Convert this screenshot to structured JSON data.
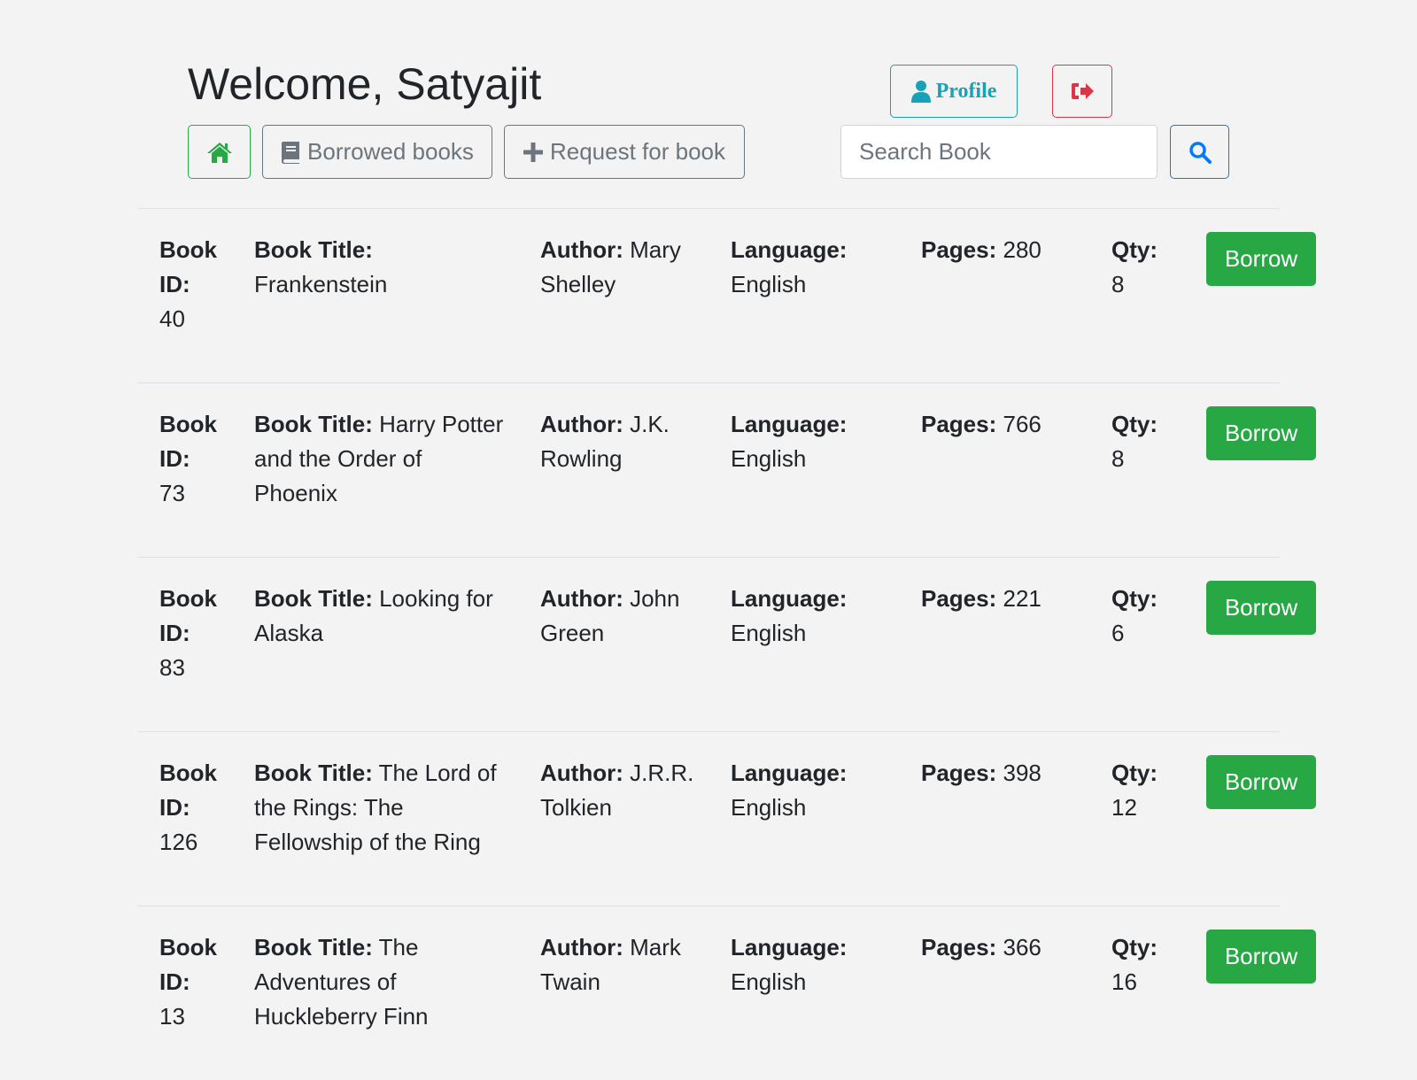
{
  "header": {
    "welcome": "Welcome, Satyajit",
    "profile_label": "Profile",
    "nav": {
      "borrowed_label": "Borrowed books",
      "request_label": "Request for book"
    },
    "search": {
      "placeholder": "Search Book",
      "value": ""
    }
  },
  "labels": {
    "book_id": "Book ID:",
    "title": "Book Title:",
    "author": "Author:",
    "language": "Language:",
    "pages": "Pages:",
    "qty": "Qty:",
    "borrow": "Borrow"
  },
  "books": [
    {
      "id": "40",
      "title": "Frankenstein",
      "author": "Mary Shelley",
      "language": "English",
      "pages": "280",
      "qty": "8"
    },
    {
      "id": "73",
      "title": "Harry Potter and the Order of Phoenix",
      "author": "J.K. Rowling",
      "language": "English",
      "pages": "766",
      "qty": "8"
    },
    {
      "id": "83",
      "title": "Looking for Alaska",
      "author": "John Green",
      "language": "English",
      "pages": "221",
      "qty": "6"
    },
    {
      "id": "126",
      "title": "The Lord of the Rings: The Fellowship of the Ring",
      "author": "J.R.R. Tolkien",
      "language": "English",
      "pages": "398",
      "qty": "12"
    },
    {
      "id": "13",
      "title": "The Adventures of Huckleberry Finn",
      "author": "Mark Twain",
      "language": "English",
      "pages": "366",
      "qty": "16"
    }
  ],
  "colors": {
    "success": "#28a745",
    "info": "#17a2b8",
    "danger": "#dc3545",
    "primary": "#007bff",
    "secondary": "#6c757d"
  },
  "icons": {
    "profile": "user-icon",
    "logout": "sign-out-icon",
    "home": "home-icon",
    "borrowed": "book-icon",
    "request": "plus-icon",
    "search": "search-icon"
  }
}
